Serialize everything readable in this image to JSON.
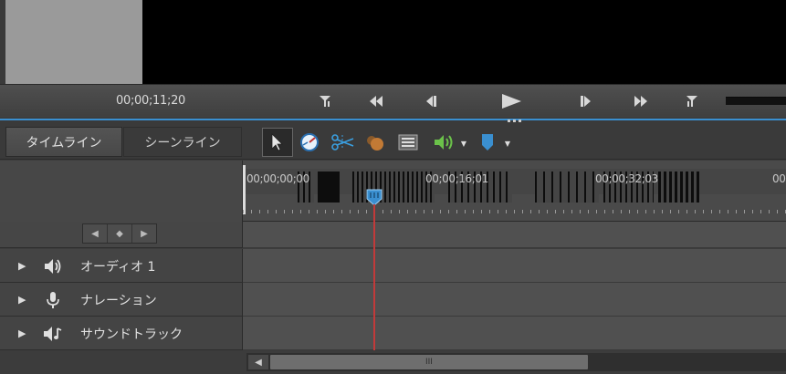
{
  "monitor": {
    "timecode": "00;00;11;20"
  },
  "transport": {
    "buttons": [
      {
        "name": "set-in-point",
        "icon": "mark-in-icon"
      },
      {
        "name": "rewind",
        "icon": "rewind-icon"
      },
      {
        "name": "step-back",
        "icon": "step-back-icon"
      },
      {
        "name": "play",
        "icon": "play-icon"
      },
      {
        "name": "step-forward",
        "icon": "step-forward-icon"
      },
      {
        "name": "fast-forward",
        "icon": "fast-forward-icon"
      },
      {
        "name": "set-out-point",
        "icon": "mark-out-icon"
      }
    ]
  },
  "tabs": {
    "timeline": "タイムライン",
    "sceneline": "シーンライン"
  },
  "tools": [
    {
      "name": "selection-tool",
      "icon": "arrow-pointer-icon",
      "selected": true
    },
    {
      "name": "time-stretch-tool",
      "icon": "clock-icon"
    },
    {
      "name": "smart-trim-tool",
      "icon": "scissors-icon"
    },
    {
      "name": "smart-mix-tool",
      "icon": "mixer-icon"
    },
    {
      "name": "clip-list",
      "icon": "list-icon"
    },
    {
      "name": "audio-menu",
      "icon": "speaker-icon",
      "dropdown": true
    },
    {
      "name": "marker-menu",
      "icon": "marker-icon",
      "dropdown": true
    }
  ],
  "ruler": {
    "timecodes": [
      "00;00;00;00",
      "00;00;16;01",
      "00;00;32;03",
      "00"
    ]
  },
  "tracks": [
    {
      "name": "audio-1",
      "label": "オーディオ 1",
      "icon": "speaker-icon"
    },
    {
      "name": "narration",
      "label": "ナレーション",
      "icon": "microphone-icon"
    },
    {
      "name": "soundtrack",
      "label": "サウンドトラック",
      "icon": "music-speaker-icon"
    }
  ],
  "scrollbar": {
    "grip": "III"
  },
  "colors": {
    "accent_blue": "#3a8fd0",
    "playhead_red": "#c23a3a",
    "panel_bg": "#3c3c3c"
  }
}
